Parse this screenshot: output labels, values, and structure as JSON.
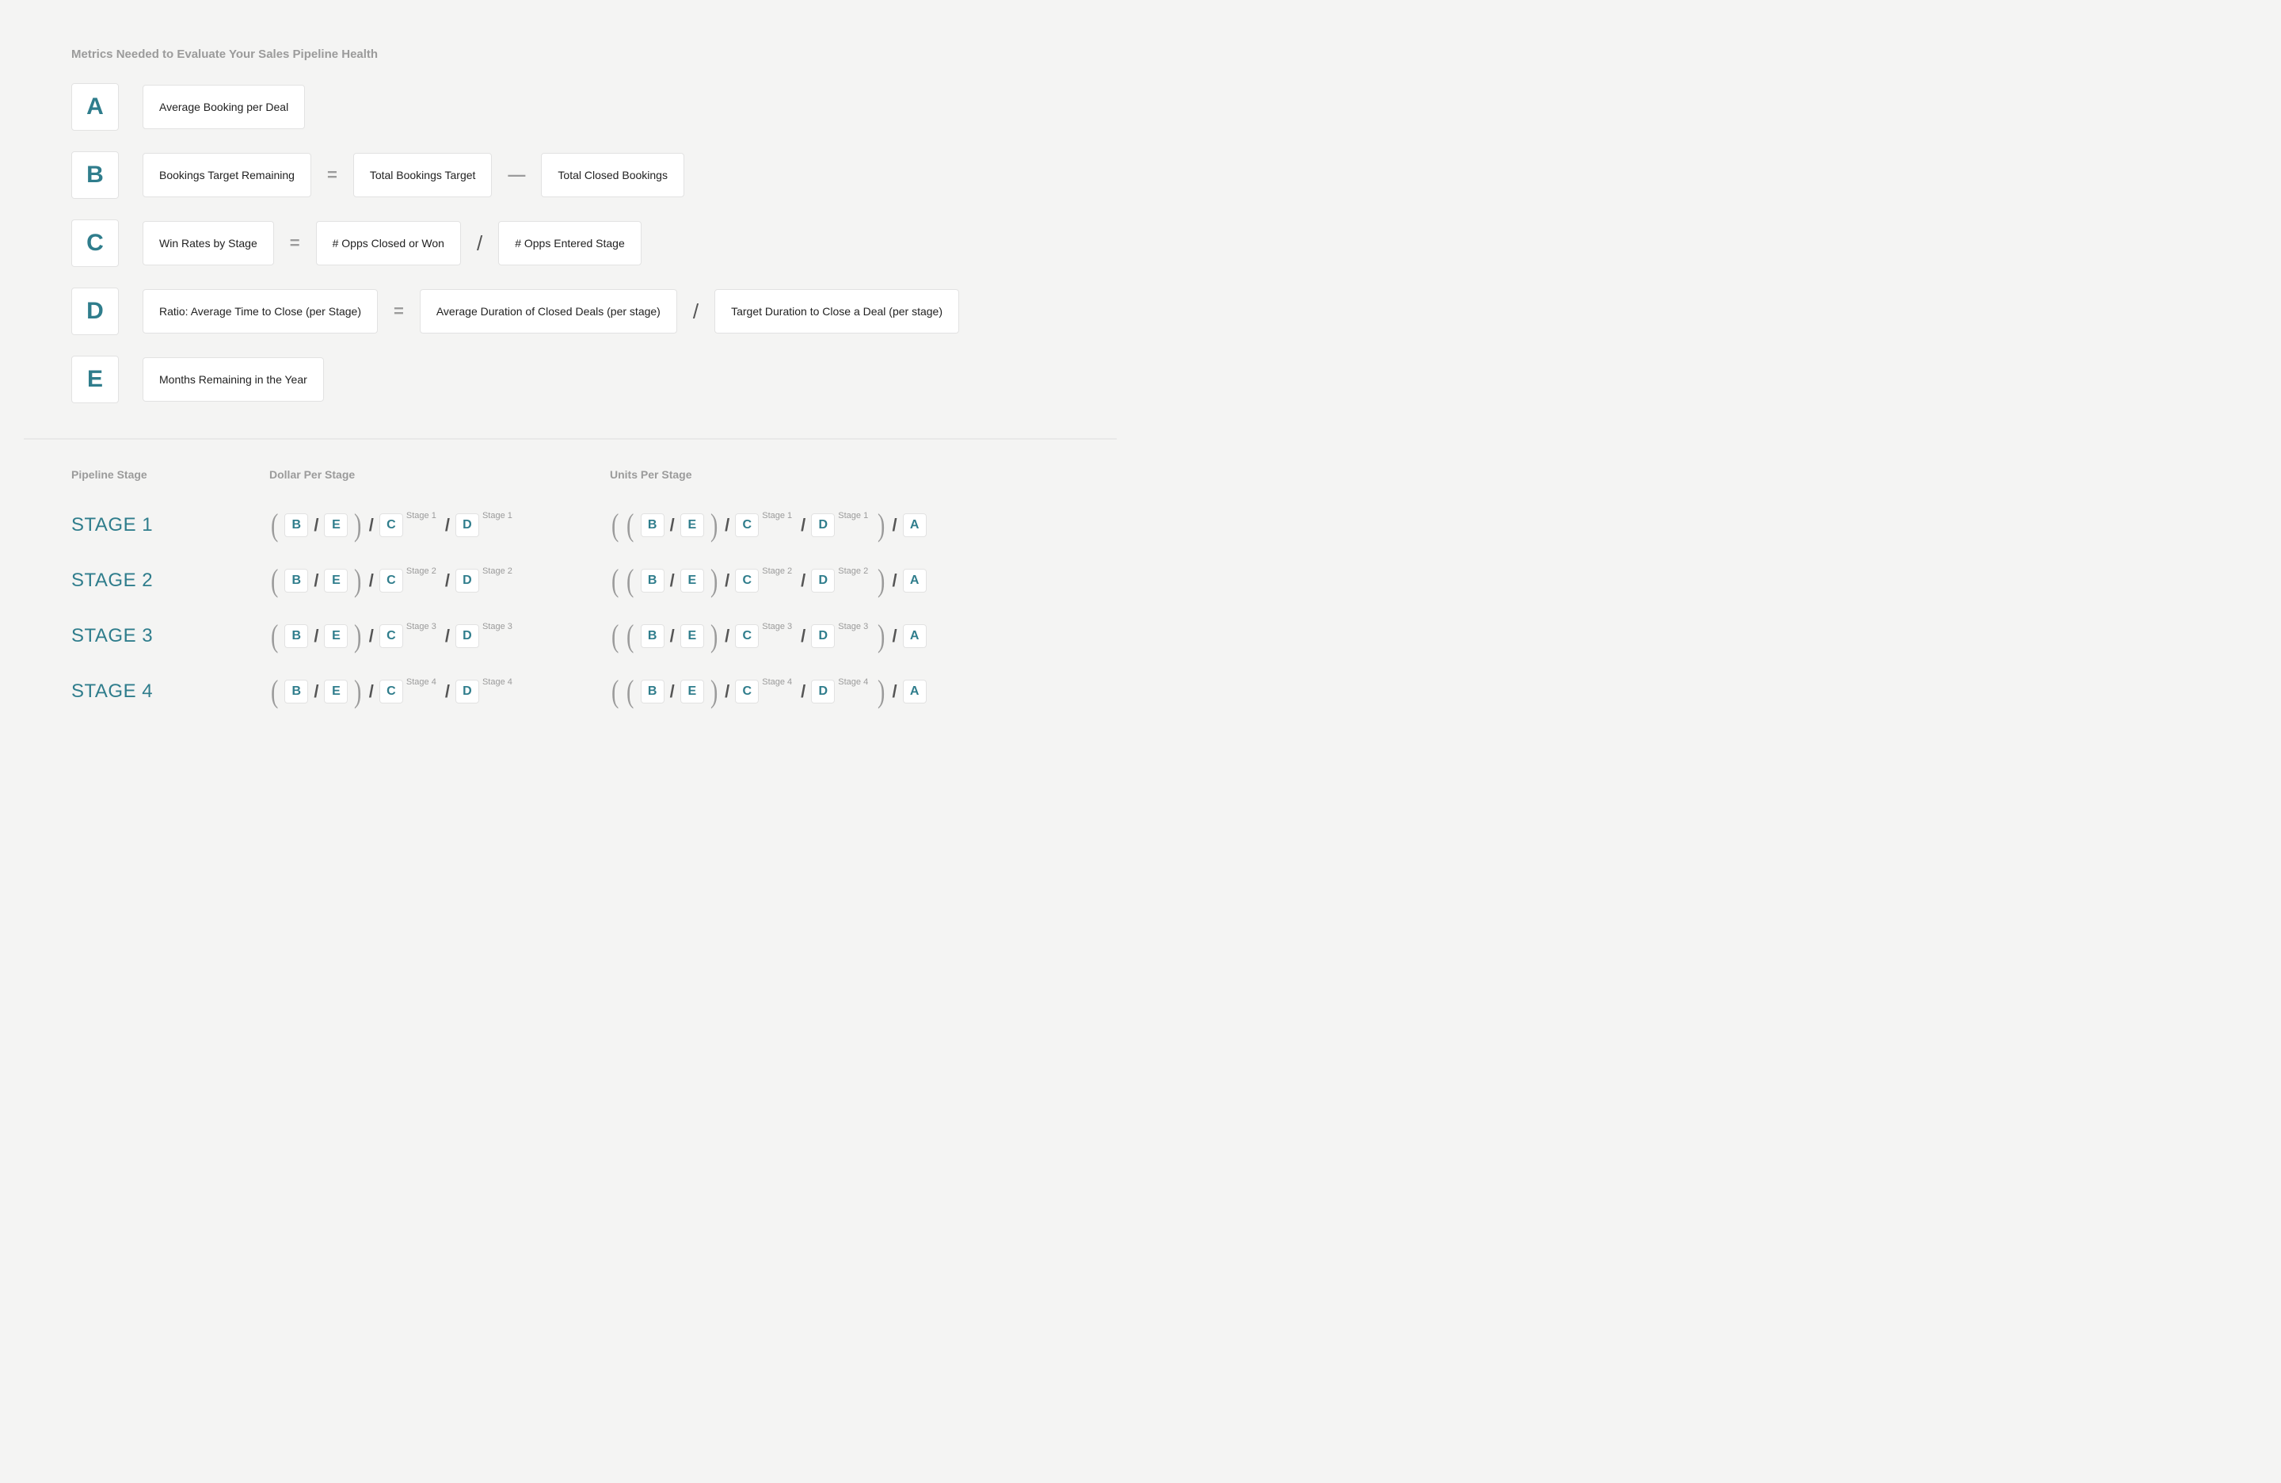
{
  "title": "Metrics Needed to Evaluate Your Sales Pipeline Health",
  "metrics": {
    "A": {
      "letter": "A",
      "definition": "Average Booking per Deal"
    },
    "B": {
      "letter": "B",
      "result": "Bookings Target Remaining",
      "op": "=",
      "lhs": "Total Bookings Target",
      "mid_op": "—",
      "rhs": "Total Closed Bookings"
    },
    "C": {
      "letter": "C",
      "result": "Win Rates by Stage",
      "op": "=",
      "lhs": "# Opps Closed or Won",
      "mid_op": "/",
      "rhs": "# Opps Entered Stage"
    },
    "D": {
      "letter": "D",
      "result": "Ratio: Average Time to Close (per Stage)",
      "op": "=",
      "lhs": "Average Duration of Closed Deals (per stage)",
      "mid_op": "/",
      "rhs": "Target Duration to Close a Deal (per stage)"
    },
    "E": {
      "letter": "E",
      "definition": "Months Remaining in the Year"
    }
  },
  "columns": {
    "stage": "Pipeline Stage",
    "dollar": "Dollar Per Stage",
    "units": "Units Per Stage"
  },
  "stages": [
    {
      "label": "STAGE 1",
      "sup": "Stage 1"
    },
    {
      "label": "STAGE 2",
      "sup": "Stage 2"
    },
    {
      "label": "STAGE 3",
      "sup": "Stage 3"
    },
    {
      "label": "STAGE 4",
      "sup": "Stage 4"
    }
  ],
  "chips": {
    "A": "A",
    "B": "B",
    "C": "C",
    "D": "D",
    "E": "E"
  }
}
